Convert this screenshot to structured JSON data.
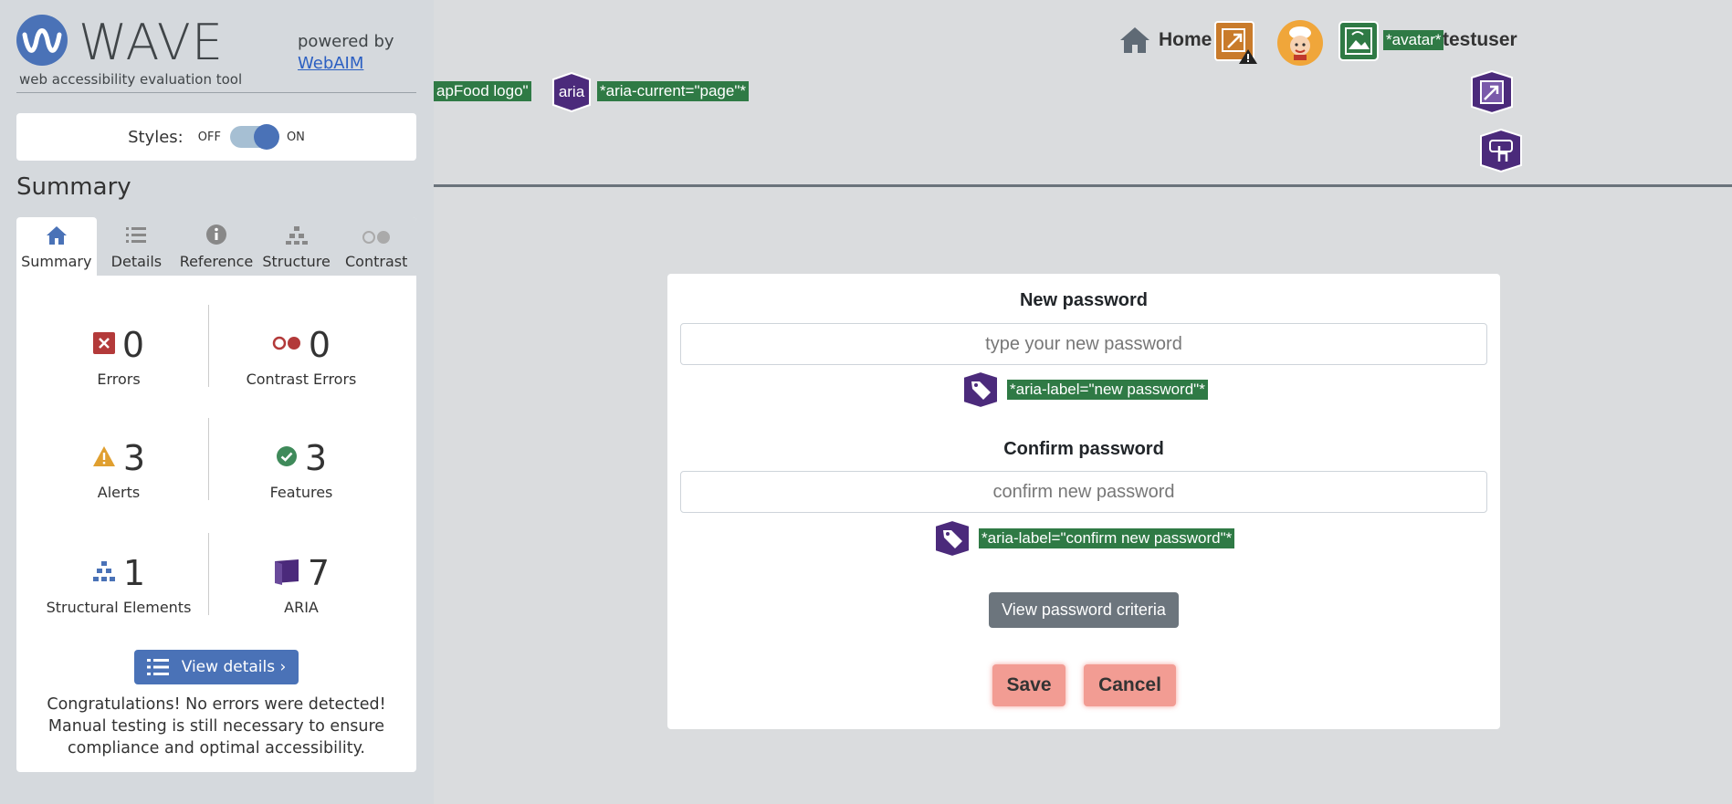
{
  "wave": {
    "logo_text": "WAVE",
    "tagline": "web accessibility evaluation tool",
    "powered_by": "powered by",
    "webaim_link": "WebAIM",
    "styles": {
      "label": "Styles:",
      "off": "OFF",
      "on": "ON",
      "state": "on"
    },
    "summary_title": "Summary",
    "tabs": [
      {
        "label": "Summary",
        "icon": "home-icon",
        "active": true
      },
      {
        "label": "Details",
        "icon": "list-icon"
      },
      {
        "label": "Reference",
        "icon": "info-icon"
      },
      {
        "label": "Structure",
        "icon": "hierarchy-icon"
      },
      {
        "label": "Contrast",
        "icon": "contrast-icon"
      }
    ],
    "stats": {
      "errors": {
        "count": "0",
        "label": "Errors"
      },
      "contrast_errors": {
        "count": "0",
        "label": "Contrast Errors"
      },
      "alerts": {
        "count": "3",
        "label": "Alerts"
      },
      "features": {
        "count": "3",
        "label": "Features"
      },
      "structural": {
        "count": "1",
        "label": "Structural Elements"
      },
      "aria": {
        "count": "7",
        "label": "ARIA"
      }
    },
    "view_details": "View details ›",
    "congrats": "Congratulations! No errors were detected! Manual testing is still necessary to ensure compliance and optimal accessibility."
  },
  "header": {
    "logo_tag": "apFood logo\"",
    "aria_icon_text": "aria",
    "aria_current_tag": "*aria-current=\"page\"*",
    "home_label": "Home",
    "avatar_tag": "*avatar*",
    "username": "testuser"
  },
  "form": {
    "new_password_label": "New password",
    "new_password_placeholder": "type your new password",
    "new_password_aria": "*aria-label=\"new password\"*",
    "confirm_password_label": "Confirm password",
    "confirm_password_placeholder": "confirm new password",
    "confirm_password_aria": "*aria-label=\"confirm new password\"*",
    "criteria_button": "View password criteria",
    "save_button": "Save",
    "cancel_button": "Cancel"
  },
  "colors": {
    "wave_blue": "#4a72b7",
    "wave_tag_green": "#2f7a45",
    "aria_purple": "#4b2a7b",
    "error_red": "#b33a3a",
    "alert_orange": "#e09f2f",
    "feature_green": "#3f8a5a",
    "button_salmon": "#f29c93",
    "button_gray": "#6c757d"
  }
}
